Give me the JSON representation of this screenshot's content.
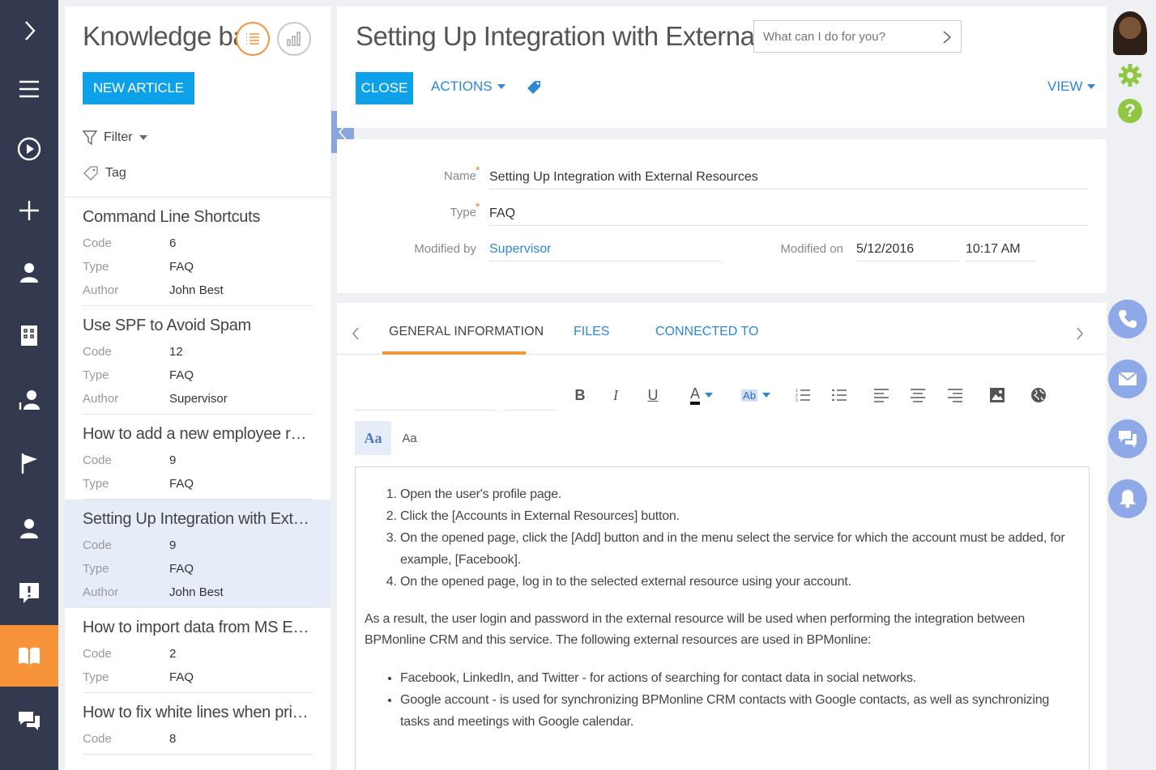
{
  "nav": {
    "items": [
      {
        "name": "nav-expand",
        "icon": "chevron-right-icon"
      },
      {
        "name": "nav-menu",
        "icon": "hamburger-icon"
      },
      {
        "name": "nav-process",
        "icon": "play-circle-icon"
      },
      {
        "name": "nav-add",
        "icon": "plus-icon"
      },
      {
        "name": "nav-contacts",
        "icon": "person-icon"
      },
      {
        "name": "nav-accounts",
        "icon": "building-icon"
      },
      {
        "name": "nav-employees",
        "icon": "employee-icon"
      },
      {
        "name": "nav-activities",
        "icon": "flag-icon"
      },
      {
        "name": "nav-users",
        "icon": "user-icon"
      },
      {
        "name": "nav-cases",
        "icon": "alert-icon"
      },
      {
        "name": "nav-knowledge-base",
        "icon": "book-icon"
      },
      {
        "name": "nav-feed",
        "icon": "chat-icon"
      }
    ],
    "active_color": "#f7933a",
    "background": "#33394f"
  },
  "list": {
    "title": "Knowledge ba..",
    "new_article_label": "NEW ARTICLE",
    "filter_label": "Filter",
    "tag_label": "Tag",
    "articles": [
      {
        "title": "Command Line Shortcuts",
        "rows": [
          {
            "k": "Code",
            "v": "6"
          },
          {
            "k": "Type",
            "v": "FAQ"
          },
          {
            "k": "Author",
            "v": "John Best"
          }
        ]
      },
      {
        "title": "Use SPF to Avoid Spam",
        "rows": [
          {
            "k": "Code",
            "v": "12"
          },
          {
            "k": "Type",
            "v": "FAQ"
          },
          {
            "k": "Author",
            "v": "Supervisor"
          }
        ]
      },
      {
        "title": "How to add a new employee record",
        "rows": [
          {
            "k": "Code",
            "v": "9"
          },
          {
            "k": "Type",
            "v": "FAQ"
          }
        ]
      },
      {
        "title": "Setting Up Integration with External...",
        "rows": [
          {
            "k": "Code",
            "v": "9"
          },
          {
            "k": "Type",
            "v": "FAQ"
          },
          {
            "k": "Author",
            "v": "John Best"
          }
        ],
        "selected": true
      },
      {
        "title": "How to import data from MS Excel",
        "rows": [
          {
            "k": "Code",
            "v": "2"
          },
          {
            "k": "Type",
            "v": "FAQ"
          }
        ]
      },
      {
        "title": "How to fix white lines when printing",
        "rows": [
          {
            "k": "Code",
            "v": "8"
          }
        ]
      }
    ]
  },
  "header": {
    "title": "Setting Up Integration with External R...",
    "search_placeholder": "What can I do for you?",
    "close_label": "CLOSE",
    "actions_label": "ACTIONS",
    "view_label": "VIEW",
    "accent": "#0da1e9"
  },
  "fields": {
    "name_label": "Name",
    "name_value": "Setting Up Integration with External Resources",
    "type_label": "Type",
    "type_value": "FAQ",
    "modified_by_label": "Modified by",
    "modified_by_value": "Supervisor",
    "modified_on_label": "Modified on",
    "modified_on_date": "5/12/2016",
    "modified_on_time": "10:17 AM",
    "required_mark": "*"
  },
  "tabs": [
    {
      "label": "GENERAL INFORMATION",
      "active": true
    },
    {
      "label": "FILES",
      "active": false
    },
    {
      "label": "CONNECTED TO",
      "active": false
    }
  ],
  "toolbar": {
    "bold": "B",
    "italic": "I",
    "underline": "U",
    "font_color": "A",
    "highlight": "Ab",
    "format_rich": "Aa",
    "format_plain": "Aa"
  },
  "editor": {
    "steps": [
      "Open the user's profile page.",
      "Click the [Accounts in External Resources] button.",
      "On the opened page, click the [Add] button and in the menu select the service for which the account must be added, for example, [Facebook].",
      "On the opened page, log in to the selected external resource using your account."
    ],
    "paragraph": "As a result, the user login and password in the external resource will be used when performing the integration between BPMonline CRM and this service. The following external resources are used in BPMonline:",
    "bullets": [
      "Facebook, LinkedIn, and Twitter - for actions of searching for contact data in social networks.",
      "Google account - is used for synchronizing BPMonline CRM contacts with Google contacts, as well as synchronizing tasks and meetings with Google calendar."
    ]
  },
  "rightrail": {
    "gear_color": "#8fc742",
    "help_label": "?",
    "comm_color": "#8fa8e8"
  }
}
